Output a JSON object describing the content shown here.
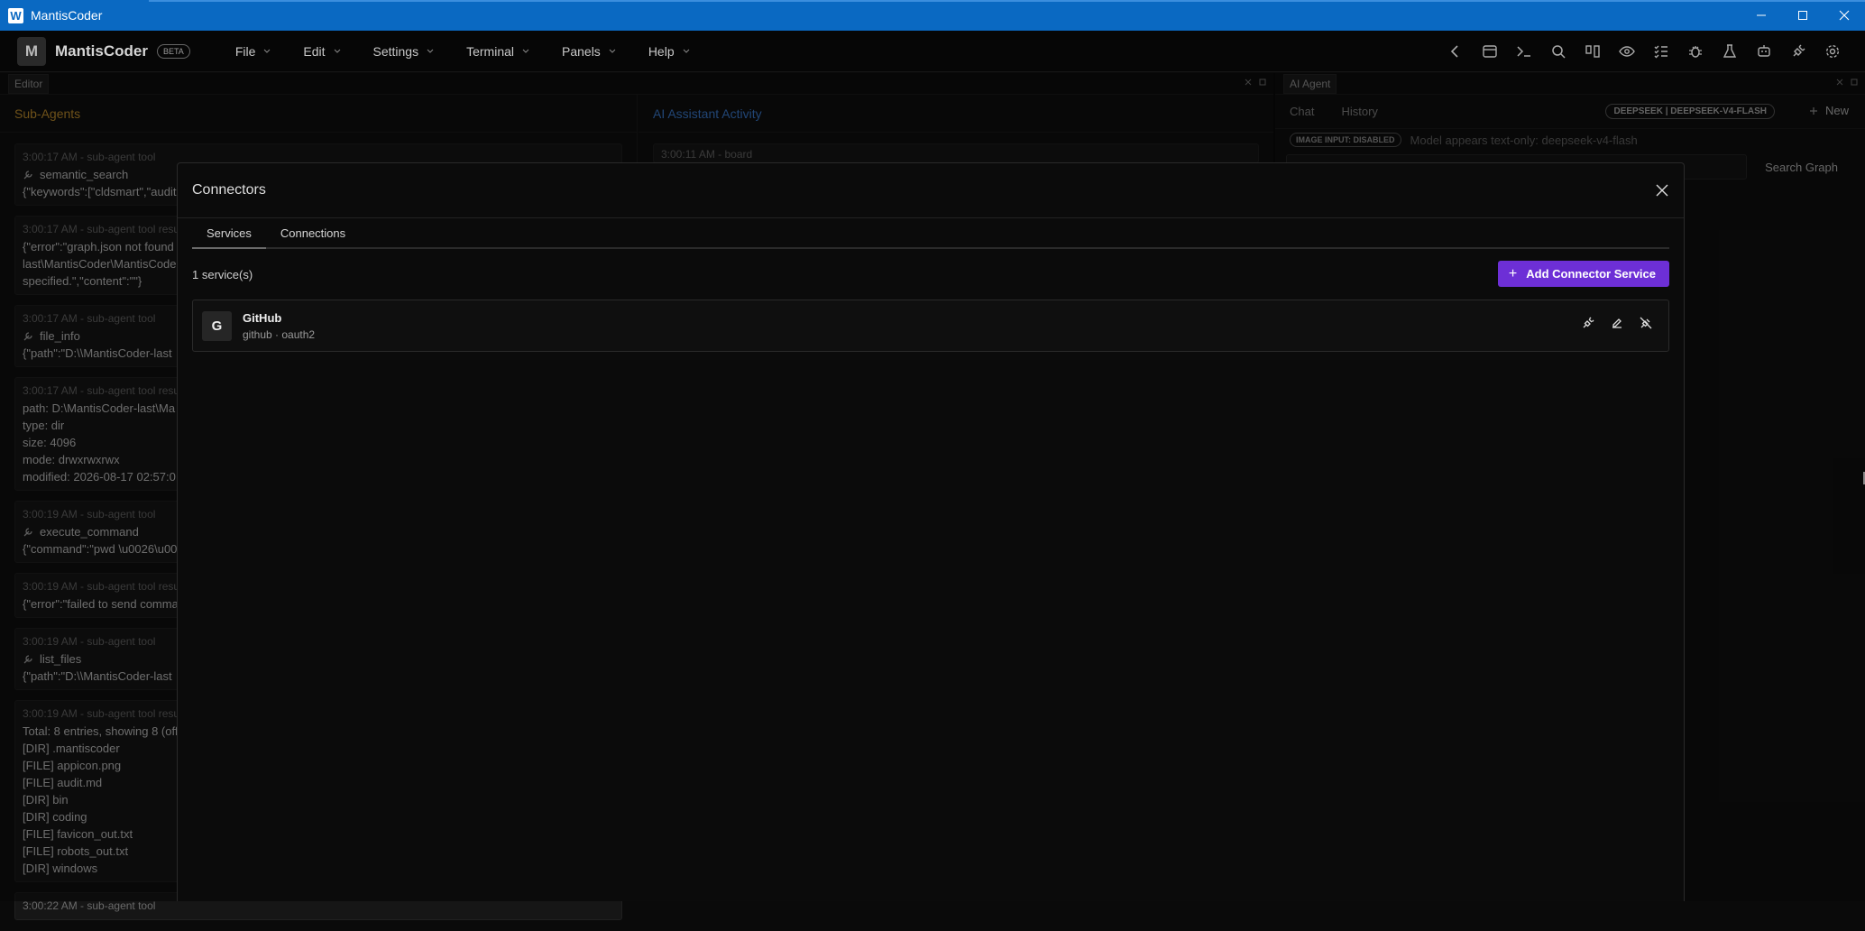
{
  "window": {
    "title": "MantisCoder",
    "badge": "W"
  },
  "brand": {
    "logo_letter": "M",
    "name": "MantisCoder",
    "beta": "BETA"
  },
  "menus": [
    "File",
    "Edit",
    "Settings",
    "Terminal",
    "Panels",
    "Help"
  ],
  "toolbar_icons": [
    "chevron-left-icon",
    "window-icon",
    "terminal-icon",
    "search-icon",
    "git-compare-icon",
    "eye-icon",
    "checklist-icon",
    "bug-icon",
    "flask-icon",
    "robot-icon",
    "plug-icon",
    "gear-icon"
  ],
  "editor": {
    "tag": "Editor",
    "subagents_title": "Sub-Agents",
    "activity_title": "AI Assistant Activity",
    "activity_first": "3:00:11 AM - board",
    "logs": [
      {
        "meta": "3:00:17 AM - sub-agent tool",
        "tool": "semantic_search",
        "lines": [
          "{\"keywords\":[\"cldsmart\",\"audit"
        ]
      },
      {
        "meta": "3:00:17 AM - sub-agent tool resu",
        "lines": [
          "{\"error\":\"graph.json not found",
          "last\\MantisCoder\\MantisCode",
          "specified.\",\"content\":\"\"}"
        ]
      },
      {
        "meta": "3:00:17 AM - sub-agent tool",
        "tool": "file_info",
        "lines": [
          "{\"path\":\"D:\\\\MantisCoder-last"
        ]
      },
      {
        "meta": "3:00:17 AM - sub-agent tool resu",
        "lines": [
          "path: D:\\MantisCoder-last\\Ma",
          "type: dir",
          "size: 4096",
          "mode: drwxrwxrwx",
          "modified: 2026-08-17 02:57:0"
        ]
      },
      {
        "meta": "3:00:19 AM - sub-agent tool",
        "tool": "execute_command",
        "lines": [
          "{\"command\":\"pwd \\u0026\\u00"
        ]
      },
      {
        "meta": "3:00:19 AM - sub-agent tool resu",
        "lines": [
          "{\"error\":\"failed to send comma"
        ]
      },
      {
        "meta": "3:00:19 AM - sub-agent tool",
        "tool": "list_files",
        "lines": [
          "{\"path\":\"D:\\\\MantisCoder-last"
        ]
      },
      {
        "meta": "3:00:19 AM - sub-agent tool resu",
        "lines": [
          "Total: 8 entries, showing 8 (off",
          "[DIR]  .mantiscoder",
          "[FILE] appicon.png",
          "[FILE] audit.md",
          "[DIR]  bin",
          "[DIR]  coding",
          "[FILE] favicon_out.txt",
          "[FILE] robots_out.txt",
          "[DIR]  windows"
        ]
      },
      {
        "meta": "3:00:22 AM - sub-agent tool",
        "lines": []
      }
    ]
  },
  "agent": {
    "tag": "AI Agent",
    "tabs": [
      "Chat",
      "History"
    ],
    "model": "DEEPSEEK | DEEPSEEK-V4-FLASH",
    "new_label": "New",
    "image_input": "IMAGE INPUT: DISABLED",
    "image_note": "Model appears text-only: deepseek-v4-flash",
    "search_graph": "Search Graph"
  },
  "modal": {
    "title": "Connectors",
    "tabs": [
      "Services",
      "Connections"
    ],
    "service_count": "1 service(s)",
    "add_button": "Add Connector Service",
    "services": [
      {
        "initial": "G",
        "name": "GitHub",
        "subtitle": "github · oauth2"
      }
    ]
  }
}
